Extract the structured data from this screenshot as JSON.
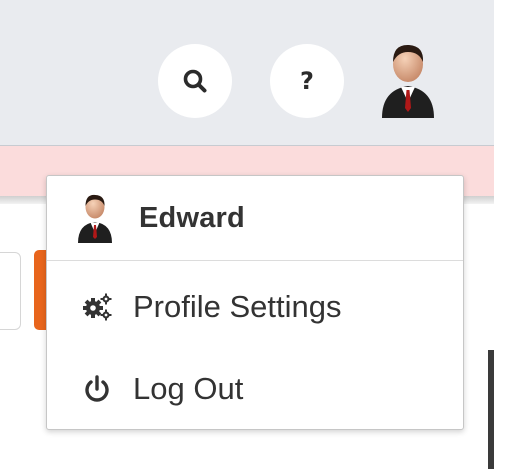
{
  "header": {
    "search_icon": "search-icon",
    "help_label": "?",
    "avatar_icon": "user-avatar-icon"
  },
  "user_menu": {
    "username": "Edward",
    "items": [
      {
        "label": "Profile Settings",
        "icon": "cogs-icon"
      },
      {
        "label": "Log Out",
        "icon": "power-icon"
      }
    ]
  },
  "colors": {
    "top_bar": "#e9ebef",
    "alert_strip": "#fbdcdc",
    "accent": "#e8651c",
    "text": "#333333"
  }
}
